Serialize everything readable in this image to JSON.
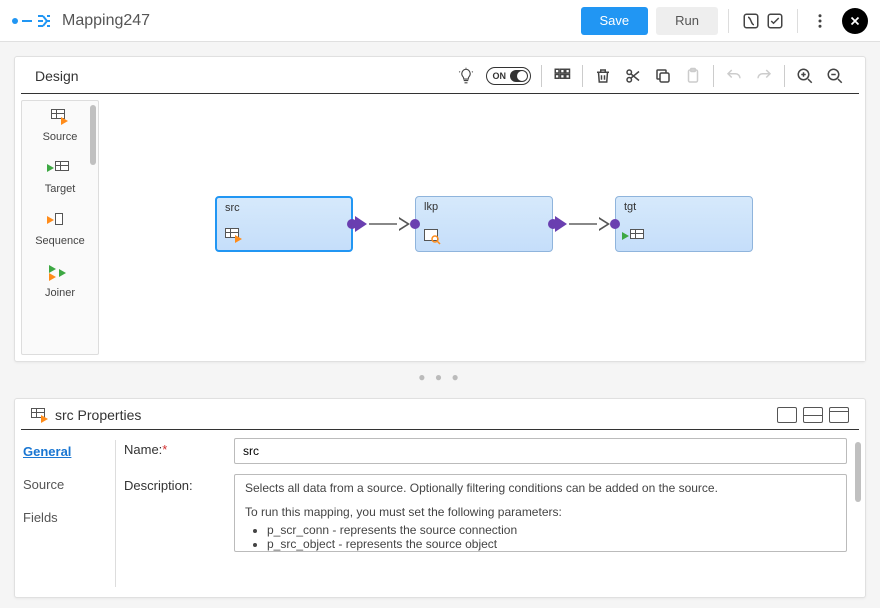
{
  "header": {
    "title": "Mapping247",
    "save_label": "Save",
    "run_label": "Run"
  },
  "design": {
    "label": "Design",
    "toggle_label": "ON"
  },
  "palette": {
    "items": [
      {
        "label": "Source"
      },
      {
        "label": "Target"
      },
      {
        "label": "Sequence"
      },
      {
        "label": "Joiner"
      }
    ]
  },
  "nodes": {
    "src": {
      "label": "src"
    },
    "lkp": {
      "label": "lkp"
    },
    "tgt": {
      "label": "tgt"
    }
  },
  "props": {
    "title": "src Properties",
    "tabs": {
      "general": "General",
      "source": "Source",
      "fields": "Fields"
    },
    "name_label": "Name:",
    "name_value": "src",
    "desc_label": "Description:",
    "desc_line1": "Selects all data from a source. Optionally filtering conditions can be added on the source.",
    "desc_line2": "To run this mapping, you must set the following parameters:",
    "desc_bullet1": "p_scr_conn - represents the source connection",
    "desc_bullet2": "p_src_object - represents the source object"
  }
}
